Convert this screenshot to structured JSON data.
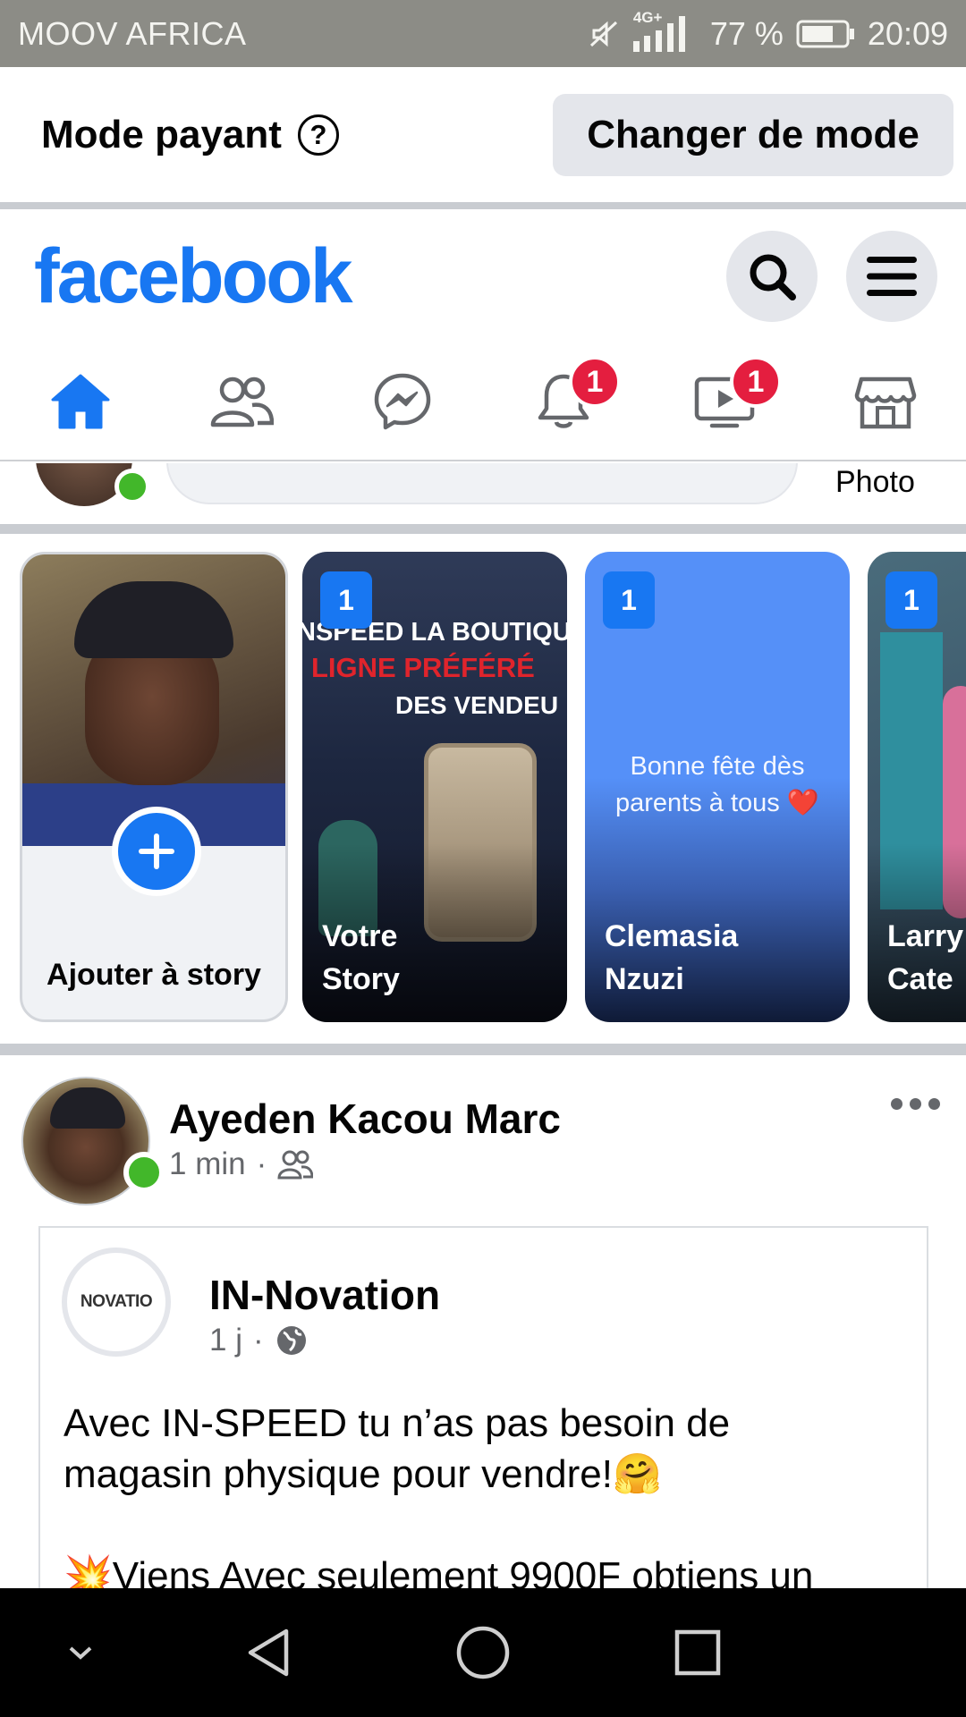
{
  "status_bar": {
    "carrier": "MOOV AFRICA",
    "network": "4G+",
    "battery": "77 %",
    "time": "20:09",
    "icons": [
      "mute-icon",
      "signal-icon",
      "battery-icon"
    ]
  },
  "mode_bar": {
    "label": "Mode payant",
    "help_icon": "?",
    "button": "Changer de mode"
  },
  "header": {
    "logo": "facebook",
    "search_icon": "search-icon",
    "menu_icon": "hamburger-menu-icon"
  },
  "nav_tabs": [
    {
      "name": "home",
      "icon": "home-icon",
      "active": true,
      "badge": ""
    },
    {
      "name": "friends",
      "icon": "friends-icon",
      "active": false,
      "badge": ""
    },
    {
      "name": "messenger",
      "icon": "messenger-icon",
      "active": false,
      "badge": ""
    },
    {
      "name": "notifications",
      "icon": "bell-icon",
      "active": false,
      "badge": "1"
    },
    {
      "name": "watch",
      "icon": "video-icon",
      "active": false,
      "badge": "1"
    },
    {
      "name": "marketplace",
      "icon": "marketplace-icon",
      "active": false,
      "badge": ""
    }
  ],
  "composer": {
    "photo_label": "Photo"
  },
  "stories": {
    "create_label": "Ajouter à story",
    "items": [
      {
        "name": "Votre\nStory",
        "count": "1",
        "overlay_lines": [
          "NSPEED LA BOUTIQU",
          "LIGNE PRÉFÉRÉ",
          "DES VENDEU"
        ]
      },
      {
        "name": "Clemasia\nNzuzi",
        "count": "1",
        "text": "Bonne fête dès\nparents à tous ❤️"
      },
      {
        "name": "Larry\nCate",
        "count": "1"
      }
    ]
  },
  "post": {
    "author": "Ayeden Kacou Marc",
    "time": "1 min",
    "audience_icon": "friends-audience-icon",
    "shared": {
      "page_name": "IN-Novation",
      "page_logo_text": "NOVATIO",
      "time": "1 j",
      "audience_icon": "globe-icon",
      "text": "Avec IN-SPEED tu n’as pas besoin de\nmagasin physique pour vendre!🤗\n\n💥Viens Avec seulement 9900F obtiens un"
    }
  },
  "colors": {
    "brand": "#1877f2",
    "badge": "#e41e3f",
    "online": "#42b72a",
    "status_bar": "#8c8c86"
  }
}
